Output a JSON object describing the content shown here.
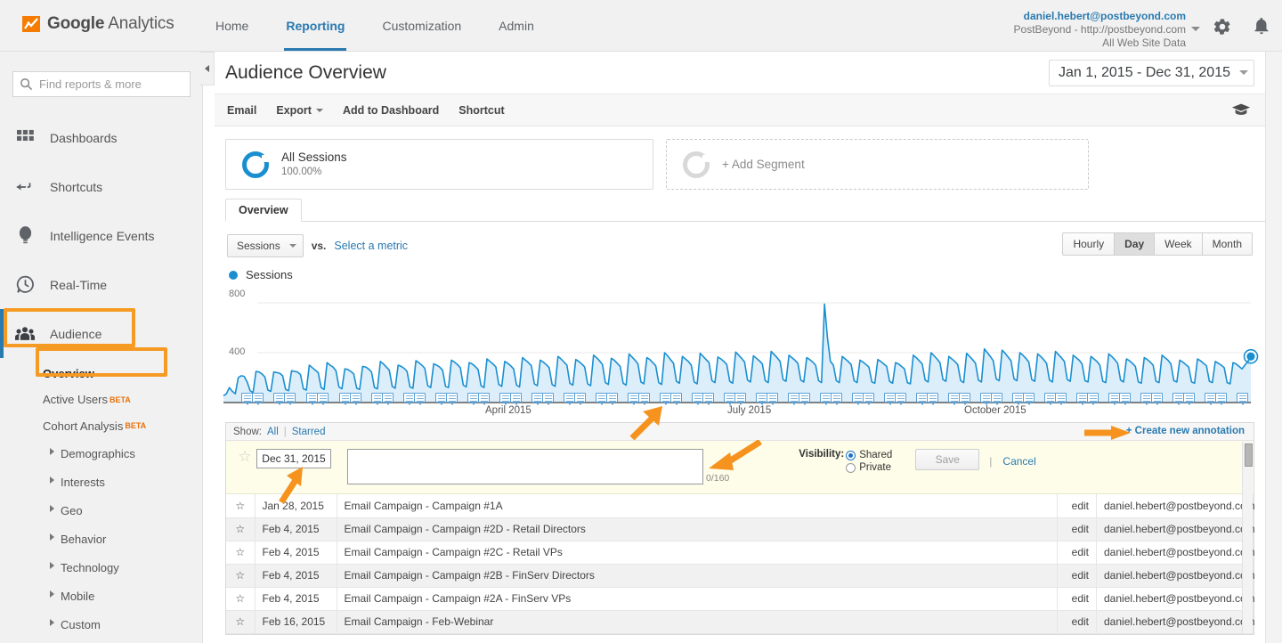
{
  "topbar": {
    "brand_bold": "Google",
    "brand_light": " Analytics",
    "nav": [
      {
        "label": "Home",
        "active": false
      },
      {
        "label": "Reporting",
        "active": true
      },
      {
        "label": "Customization",
        "active": false
      },
      {
        "label": "Admin",
        "active": false
      }
    ],
    "account_email": "daniel.hebert@postbeyond.com",
    "account_property": "PostBeyond - http://postbeyond.com",
    "account_view": "All Web Site Data",
    "settings_icon": "gear-icon",
    "notifications_icon": "bell-icon"
  },
  "sidebar": {
    "search_placeholder": "Find reports & more",
    "search_value": "",
    "items": [
      {
        "label": "Dashboards",
        "icon": "dashboards-icon"
      },
      {
        "label": "Shortcuts",
        "icon": "shortcuts-icon"
      },
      {
        "label": "Intelligence Events",
        "icon": "intelligence-icon"
      },
      {
        "label": "Real-Time",
        "icon": "realtime-icon"
      },
      {
        "label": "Audience",
        "icon": "audience-icon",
        "selected": true,
        "highlighted": true
      }
    ],
    "sub_items": [
      {
        "label": "Overview",
        "current": true,
        "highlighted": true,
        "expandable": false,
        "beta": ""
      },
      {
        "label": "Active Users",
        "current": false,
        "highlighted": false,
        "expandable": false,
        "beta": "BETA"
      },
      {
        "label": "Cohort Analysis",
        "current": false,
        "highlighted": false,
        "expandable": false,
        "beta": "BETA"
      },
      {
        "label": "Demographics",
        "current": false,
        "highlighted": false,
        "expandable": true,
        "beta": ""
      },
      {
        "label": "Interests",
        "current": false,
        "highlighted": false,
        "expandable": true,
        "beta": ""
      },
      {
        "label": "Geo",
        "current": false,
        "highlighted": false,
        "expandable": true,
        "beta": ""
      },
      {
        "label": "Behavior",
        "current": false,
        "highlighted": false,
        "expandable": true,
        "beta": ""
      },
      {
        "label": "Technology",
        "current": false,
        "highlighted": false,
        "expandable": true,
        "beta": ""
      },
      {
        "label": "Mobile",
        "current": false,
        "highlighted": false,
        "expandable": true,
        "beta": ""
      },
      {
        "label": "Custom",
        "current": false,
        "highlighted": false,
        "expandable": true,
        "beta": ""
      }
    ]
  },
  "page": {
    "title": "Audience Overview",
    "date_range": "Jan 1, 2015 - Dec 31, 2015",
    "actions": [
      {
        "label": "Email",
        "caret": false
      },
      {
        "label": "Export",
        "caret": true
      },
      {
        "label": "Add to Dashboard",
        "caret": false
      },
      {
        "label": "Shortcut",
        "caret": false
      }
    ],
    "help_icon": "graduation-cap-icon"
  },
  "segments": {
    "applied_name": "All Sessions",
    "applied_pct": "100.00%",
    "add_label": "+ Add Segment"
  },
  "tabs": [
    {
      "label": "Overview",
      "active": true
    }
  ],
  "chart_controls": {
    "metric": "Sessions",
    "vs_label": "vs.",
    "select_metric": "Select a metric",
    "granularity": [
      {
        "label": "Hourly",
        "active": false
      },
      {
        "label": "Day",
        "active": true
      },
      {
        "label": "Week",
        "active": false
      },
      {
        "label": "Month",
        "active": false
      }
    ],
    "legend_label": "Sessions",
    "legend_color": "#1a8fd0"
  },
  "chart_data": {
    "type": "line",
    "title": "Sessions",
    "xlabel": "",
    "ylabel": "Sessions",
    "ylim": [
      0,
      900
    ],
    "yticks": [
      400,
      800
    ],
    "grid": true,
    "legend": [
      "Sessions"
    ],
    "legend_position": "top-left",
    "xtick_labels": [
      "April 2015",
      "July 2015",
      "October 2015"
    ],
    "xtick_positions_pct": [
      26.5,
      52.0,
      77.5
    ],
    "series": [
      {
        "name": "Sessions",
        "color": "#1a8fd0",
        "values": [
          55,
          70,
          120,
          90,
          70,
          200,
          215,
          210,
          165,
          95,
          80,
          250,
          245,
          230,
          205,
          100,
          90,
          245,
          240,
          235,
          215,
          105,
          95,
          255,
          250,
          245,
          225,
          110,
          100,
          300,
          280,
          260,
          240,
          120,
          105,
          320,
          300,
          285,
          255,
          125,
          110,
          270,
          265,
          250,
          230,
          115,
          105,
          290,
          285,
          270,
          245,
          120,
          110,
          330,
          310,
          285,
          260,
          130,
          115,
          300,
          290,
          275,
          250,
          125,
          115,
          335,
          320,
          300,
          275,
          135,
          120,
          310,
          300,
          285,
          260,
          130,
          120,
          340,
          325,
          305,
          280,
          140,
          125,
          320,
          310,
          290,
          265,
          135,
          120,
          350,
          330,
          310,
          285,
          145,
          130,
          330,
          315,
          295,
          270,
          140,
          125,
          360,
          340,
          320,
          295,
          150,
          135,
          340,
          325,
          305,
          280,
          145,
          130,
          370,
          350,
          325,
          300,
          155,
          140,
          345,
          330,
          310,
          285,
          150,
          135,
          380,
          360,
          335,
          305,
          160,
          145,
          355,
          340,
          315,
          290,
          155,
          140,
          390,
          365,
          340,
          310,
          165,
          150,
          360,
          345,
          320,
          295,
          160,
          145,
          400,
          375,
          345,
          315,
          170,
          155,
          370,
          350,
          330,
          300,
          165,
          150,
          395,
          370,
          345,
          320,
          175,
          160,
          365,
          350,
          330,
          305,
          170,
          155,
          405,
          380,
          355,
          325,
          180,
          165,
          375,
          355,
          335,
          310,
          175,
          160,
          410,
          385,
          360,
          330,
          185,
          170,
          380,
          360,
          340,
          315,
          180,
          165,
          360,
          345,
          325,
          300,
          175,
          160,
          790,
          520,
          330,
          300,
          175,
          160,
          370,
          350,
          330,
          305,
          175,
          160,
          340,
          325,
          305,
          285,
          165,
          155,
          345,
          330,
          310,
          290,
          170,
          155,
          320,
          310,
          290,
          270,
          160,
          150,
          380,
          360,
          335,
          310,
          180,
          165,
          400,
          375,
          350,
          320,
          185,
          170,
          370,
          350,
          330,
          305,
          175,
          160,
          395,
          370,
          345,
          315,
          180,
          165,
          430,
          400,
          370,
          335,
          190,
          175,
          420,
          395,
          365,
          335,
          190,
          175,
          400,
          380,
          355,
          325,
          185,
          170,
          390,
          370,
          345,
          315,
          180,
          165,
          410,
          385,
          360,
          330,
          185,
          170,
          380,
          360,
          340,
          310,
          175,
          165,
          370,
          350,
          330,
          300,
          170,
          160,
          390,
          370,
          345,
          315,
          180,
          165,
          350,
          335,
          315,
          290,
          165,
          155,
          360,
          345,
          325,
          300,
          170,
          160,
          380,
          360,
          340,
          310,
          175,
          165,
          340,
          325,
          305,
          285,
          165,
          155,
          350,
          335,
          315,
          295,
          170,
          160,
          330,
          315,
          300,
          280,
          160,
          150,
          320,
          310,
          290,
          270,
          300,
          330,
          370
        ]
      }
    ],
    "peak": {
      "value": 790,
      "note": "single-day spike near late August 2015"
    },
    "endpoint_marker": true
  },
  "annotations_panel": {
    "show_label": "Show:",
    "filters": [
      {
        "label": "All",
        "active": true
      },
      {
        "label": "Starred",
        "active": false
      }
    ],
    "create_new": "+ Create new annotation",
    "editor": {
      "date_value": "Dec 31, 2015",
      "note_value": "",
      "note_placeholder": "",
      "counter": "0/160",
      "visibility_label": "Visibility:",
      "visibility_options": [
        {
          "label": "Shared",
          "selected": true
        },
        {
          "label": "Private",
          "selected": false
        }
      ],
      "save_label": "Save",
      "save_disabled": true,
      "cancel_label": "Cancel"
    },
    "rows": [
      {
        "date": "Jan 28, 2015",
        "text": "Email Campaign - Campaign #1A",
        "edit": "edit",
        "user": "daniel.hebert@postbeyond.com"
      },
      {
        "date": "Feb 4, 2015",
        "text": "Email Campaign - Campaign #2D - Retail Directors",
        "edit": "edit",
        "user": "daniel.hebert@postbeyond.com"
      },
      {
        "date": "Feb 4, 2015",
        "text": "Email Campaign - Campaign #2C - Retail VPs",
        "edit": "edit",
        "user": "daniel.hebert@postbeyond.com"
      },
      {
        "date": "Feb 4, 2015",
        "text": "Email Campaign - Campaign #2B - FinServ Directors",
        "edit": "edit",
        "user": "daniel.hebert@postbeyond.com"
      },
      {
        "date": "Feb 4, 2015",
        "text": "Email Campaign - Campaign #2A - FinServ VPs",
        "edit": "edit",
        "user": "daniel.hebert@postbeyond.com"
      },
      {
        "date": "Feb 16, 2015",
        "text": "Email Campaign - Feb-Webinar",
        "edit": "edit",
        "user": "daniel.hebert@postbeyond.com"
      }
    ]
  },
  "callouts": {
    "color": "#f5931e",
    "markers": [
      "audience-nav-item",
      "overview-nav-item",
      "annotation-date-field",
      "annotation-note-field",
      "create-new-annotation-link",
      "chart-annotation-marker"
    ]
  }
}
